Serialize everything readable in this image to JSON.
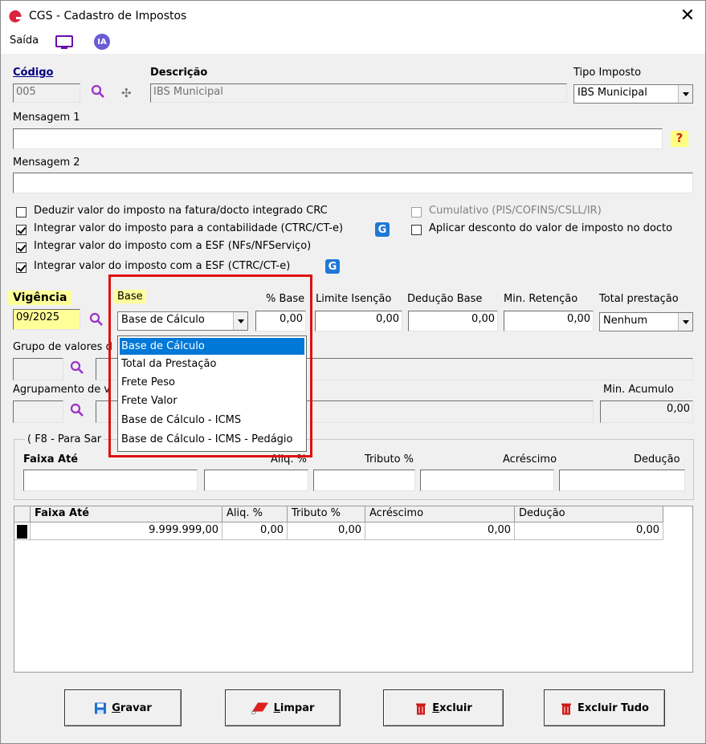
{
  "window": {
    "title": "CGS - Cadastro de Impostos",
    "close": "✕"
  },
  "menu": {
    "saida": "Saída",
    "ia": "IA"
  },
  "codigo": {
    "label": "Código",
    "value": "005"
  },
  "descricao": {
    "label": "Descrição",
    "value": "IBS Municipal"
  },
  "tipo_imposto": {
    "label": "Tipo Imposto",
    "value": "IBS Municipal"
  },
  "mensagem1": {
    "label": "Mensagem 1",
    "value": ""
  },
  "mensagem2": {
    "label": "Mensagem 2",
    "value": ""
  },
  "help": "?",
  "checkboxes": [
    {
      "label": "Deduzir valor do imposto na fatura/docto integrado CRC",
      "checked": false
    },
    {
      "label": "Integrar valor do imposto para a contabilidade (CTRC/CT-e)",
      "checked": true
    },
    {
      "label": "Integrar valor do imposto com a ESF (NFs/NFServiço)",
      "checked": true
    },
    {
      "label": "Integrar valor do imposto com a ESF (CTRC/CT-e)",
      "checked": true
    },
    {
      "label": "Cumulativo (PIS/COFINS/CSLL/IR)",
      "checked": false,
      "disabled": true
    },
    {
      "label": "Aplicar desconto do valor de imposto no docto",
      "checked": false
    }
  ],
  "g_icon": "G",
  "vigencia": {
    "label": "Vigência",
    "value": "09/2025"
  },
  "base": {
    "label": "Base",
    "value": "Base de Cálculo"
  },
  "pct_base": {
    "label": "% Base",
    "value": "0,00"
  },
  "limite_isencao": {
    "label": "Limite Isenção",
    "value": "0,00"
  },
  "deducao_base": {
    "label": "Dedução Base",
    "value": "0,00"
  },
  "min_retencao": {
    "label": "Min. Retenção",
    "value": "0,00"
  },
  "total_prestacao": {
    "label": "Total prestação",
    "value": "Nenhum"
  },
  "grupo_valores": {
    "label": "Grupo de valores d"
  },
  "agrupamento": {
    "label": "Agrupamento de v"
  },
  "min_acumulo": {
    "label": "Min. Acumulo",
    "value": "0,00"
  },
  "dropdown_options": [
    "Base de Cálculo",
    "Total da Prestação",
    "Frete Peso",
    "Frete Valor",
    "Base de Cálculo - ICMS",
    "Base de Cálculo - ICMS - Pedágio"
  ],
  "faixa": {
    "group_label": "( F8 - Para Sar",
    "faixa_ate": "Faixa Até",
    "aliq": "Aliq. %",
    "tributo": "Tributo %",
    "acrescimo": "Acréscimo",
    "deducao": "Dedução"
  },
  "grid": {
    "headers": [
      "Faixa Até",
      "Aliq. %",
      "Tributo %",
      "Acréscimo",
      "Dedução"
    ],
    "rows": [
      [
        "9.999.999,00",
        "0,00",
        "0,00",
        "0,00",
        "0,00"
      ]
    ]
  },
  "buttons": {
    "gravar": "Gravar",
    "limpar": "Limpar",
    "excluir": "Excluir",
    "excluir_tudo": "Excluir Tudo"
  },
  "colors": {
    "accent": "#0078d7",
    "highlight": "#ffff99",
    "red_box": "#e01010",
    "logo_red": "#d7263d"
  }
}
